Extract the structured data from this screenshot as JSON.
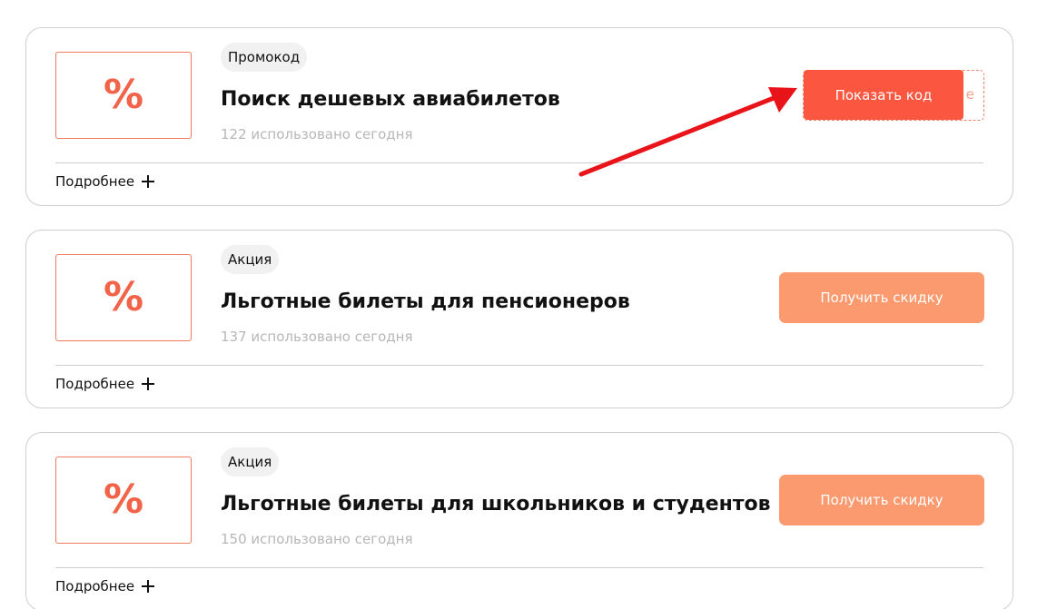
{
  "offers": [
    {
      "logo_symbol": "%",
      "badge": "Промокод",
      "title": "Поиск дешевых авиабилетов",
      "usage": "122 использовано сегодня",
      "more_label": "Подробнее",
      "button_label": "Показать код",
      "code_peek": "e"
    },
    {
      "logo_symbol": "%",
      "badge": "Акция",
      "title": "Льготные билеты для пенсионеров",
      "usage": "137 использовано сегодня",
      "more_label": "Подробнее",
      "button_label": "Получить скидку"
    },
    {
      "logo_symbol": "%",
      "badge": "Акция",
      "title": "Льготные билеты для школьников и студентов",
      "usage": "150 использовано сегодня",
      "more_label": "Подробнее",
      "button_label": "Получить скидку"
    }
  ],
  "colors": {
    "accent": "#fb5740",
    "discount_button": "#fc9a6f",
    "logo_border": "#f07a5c",
    "annotation_arrow": "#e8141a"
  },
  "icons": {
    "more": "plus-icon",
    "annotation": "red-arrow"
  }
}
